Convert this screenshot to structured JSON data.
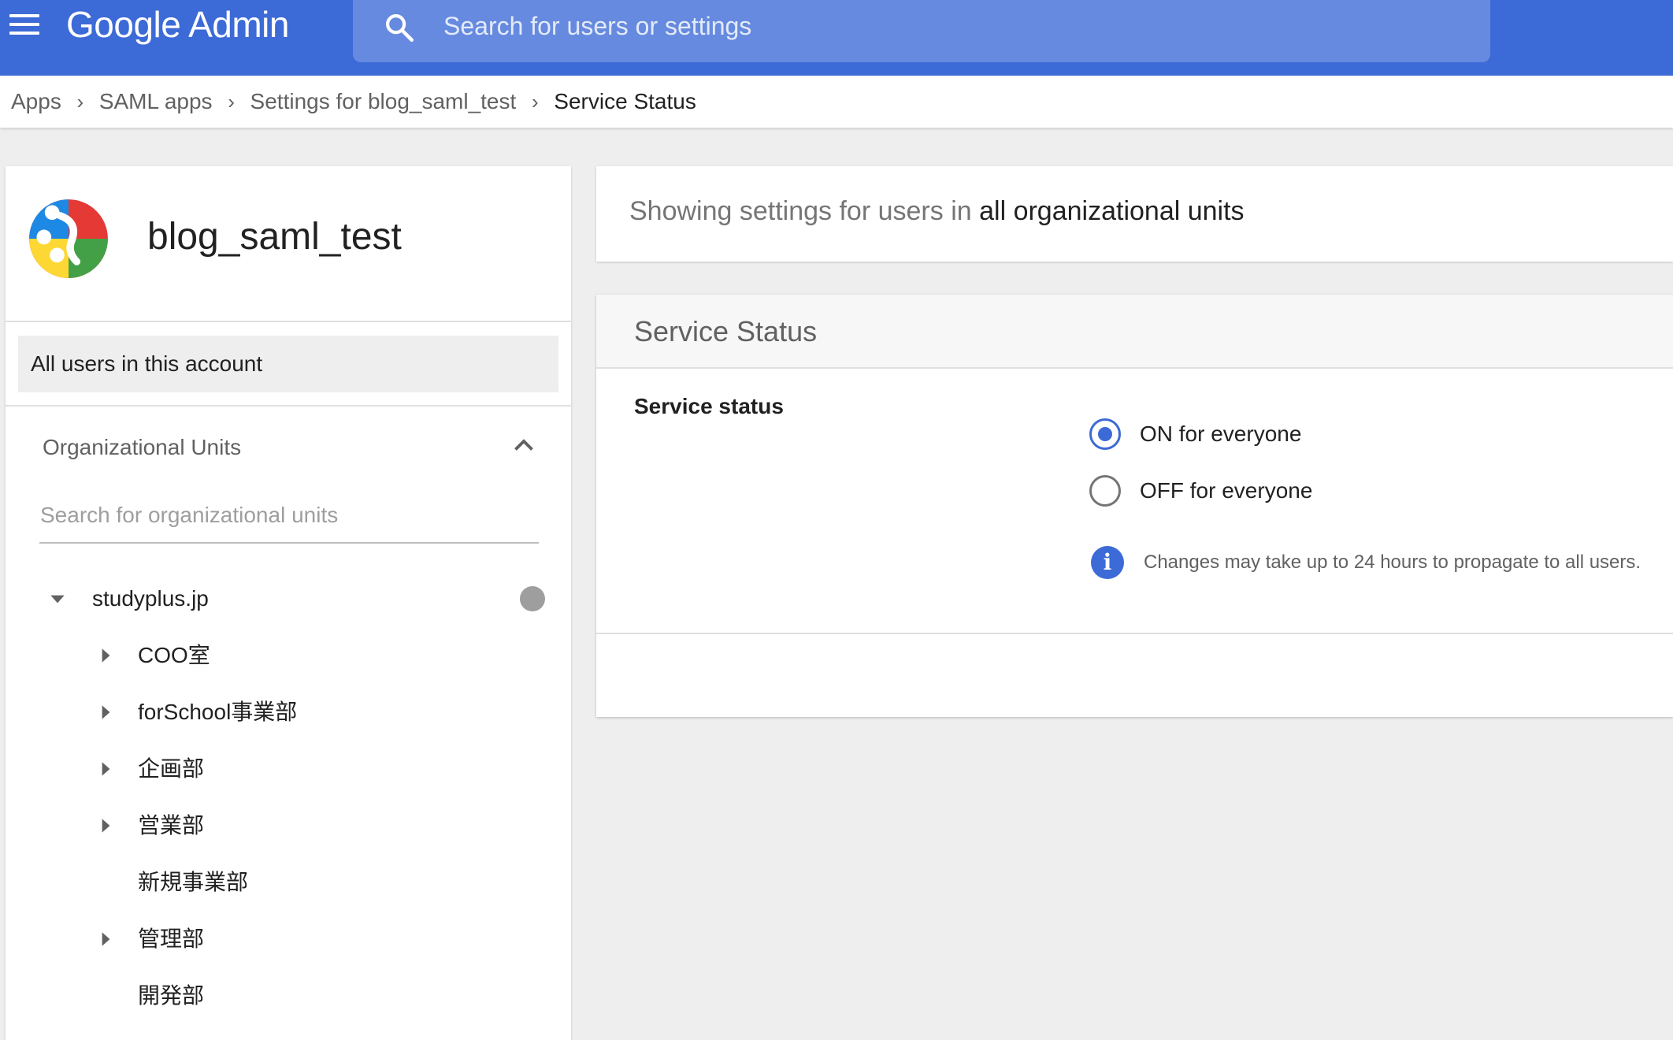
{
  "header": {
    "logo_google": "Google",
    "logo_admin": "Admin",
    "search_placeholder": "Search for users or settings",
    "bg_color": "#3c6ad6"
  },
  "breadcrumb": {
    "items": [
      "Apps",
      "SAML apps",
      "Settings for blog_saml_test",
      "Service Status"
    ]
  },
  "left_panel": {
    "app_name": "blog_saml_test",
    "all_users_label": "All users in this account",
    "ou_title": "Organizational Units",
    "ou_search_placeholder": "Search for organizational units",
    "tree": {
      "root": "studyplus.jp",
      "children": [
        {
          "label": "COO室",
          "expandable": true
        },
        {
          "label": "forSchool事業部",
          "expandable": true
        },
        {
          "label": "企画部",
          "expandable": true
        },
        {
          "label": "営業部",
          "expandable": true
        },
        {
          "label": "新規事業部",
          "expandable": false
        },
        {
          "label": "管理部",
          "expandable": true
        },
        {
          "label": "開発部",
          "expandable": false
        }
      ]
    }
  },
  "banner": {
    "prefix": "Showing settings for users in ",
    "scope": "all organizational units"
  },
  "card": {
    "title": "Service Status",
    "setting_label": "Service status",
    "options": [
      {
        "label": "ON for everyone",
        "selected": true
      },
      {
        "label": "OFF for everyone",
        "selected": false
      }
    ],
    "info_text": "Changes may take up to 24 hours to propagate to all users.",
    "accent_color": "#3c6ad6"
  }
}
